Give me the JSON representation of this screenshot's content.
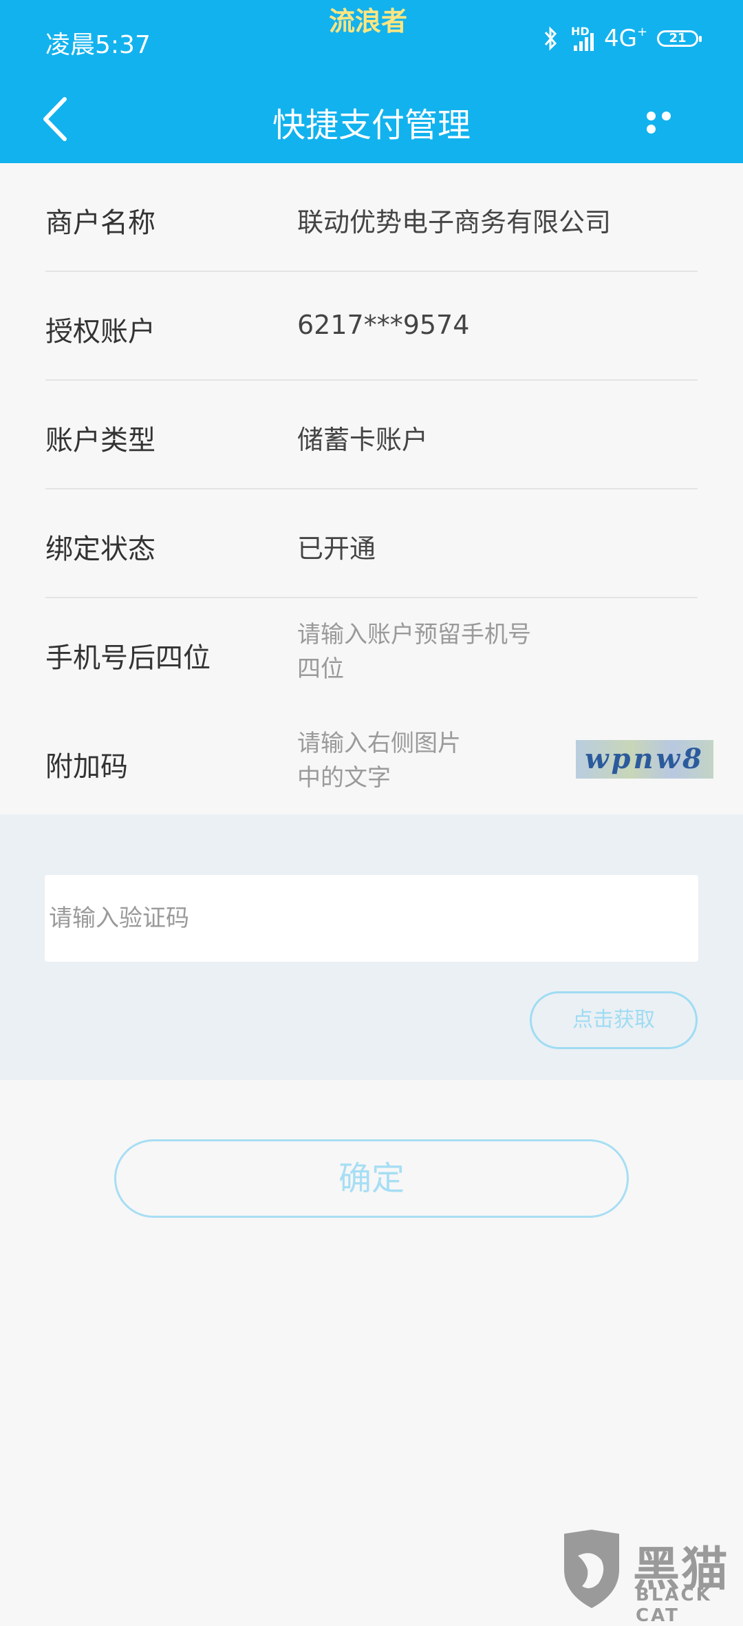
{
  "status_bar": {
    "time": "凌晨5:37",
    "overlay_text": "流浪者",
    "hd": "HD",
    "network": "4G",
    "battery": "21"
  },
  "header": {
    "title": "快捷支付管理",
    "back_icon": "chevron-left-icon",
    "more_icon": "more-dots-icon"
  },
  "details": [
    {
      "label": "商户名称",
      "value": "联动优势电子商务有限公司"
    },
    {
      "label": "授权账户",
      "value": "6217***9574"
    },
    {
      "label": "账户类型",
      "value": "储蓄卡账户"
    },
    {
      "label": "绑定状态",
      "value": "已开通"
    }
  ],
  "phone_field": {
    "label": "手机号后四位",
    "placeholder_line1": "请输入账户预留手机号",
    "placeholder_line2": "四位"
  },
  "captcha_field": {
    "label": "附加码",
    "placeholder_line1": "请输入右侧图片",
    "placeholder_line2": "中的文字",
    "image_text": "wpnw8"
  },
  "sms": {
    "placeholder": "请输入验证码",
    "get_code_label": "点击获取"
  },
  "confirm_label": "确定",
  "watermark": {
    "cn": "黑猫",
    "en": "BLACK CAT"
  },
  "colors": {
    "header_bg": "#12b2ee",
    "accent_light": "#a7def4",
    "panel_bg": "#ebf0f4"
  }
}
